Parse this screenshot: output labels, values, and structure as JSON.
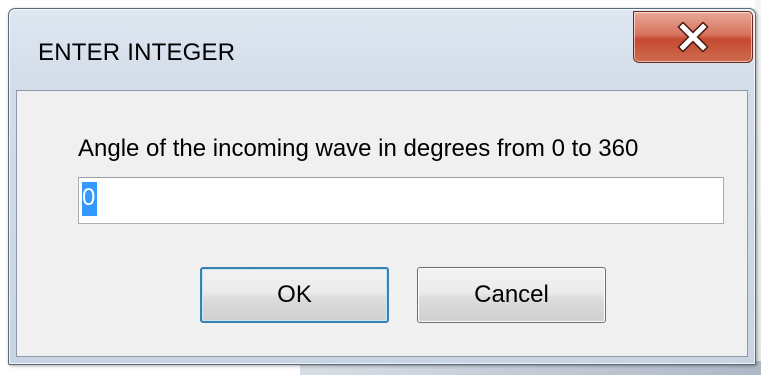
{
  "window": {
    "title": "ENTER INTEGER",
    "close_icon": "close-icon"
  },
  "dialog": {
    "prompt": "Angle of the incoming wave in degrees from 0 to 360",
    "input_value": "0",
    "input_selected": true,
    "ok_label": "OK",
    "cancel_label": "Cancel"
  },
  "colors": {
    "close_button": "#c44a31",
    "selection": "#3399ff",
    "default_button_border": "#3c7fb1"
  }
}
